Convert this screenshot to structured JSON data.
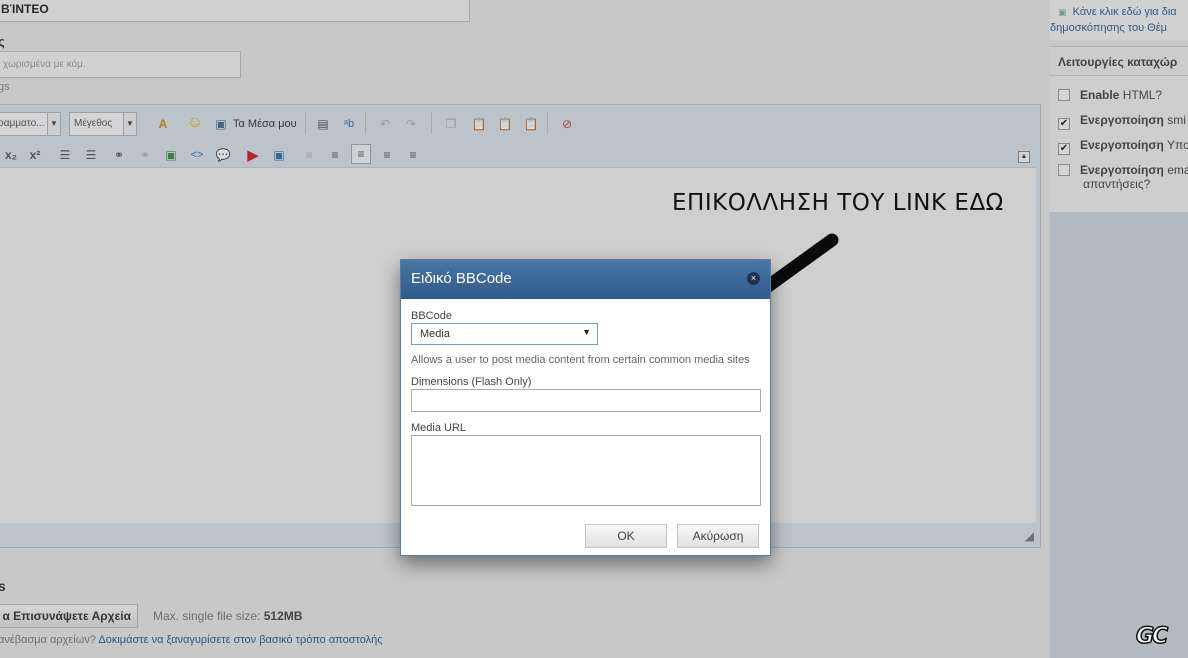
{
  "editor": {
    "title_value": "ΒΊΝΤΕΟ",
    "tags_label": "ς",
    "tags_placeholder": "χωρισμένα με κόμ.",
    "tags_hint": "gs",
    "toolbar": {
      "font_select": "ραμματο...",
      "size_select": "Μέγεθος",
      "my_media_label": "Τα Μέσα μου"
    }
  },
  "attachments": {
    "label": "s",
    "upload_button": "α Επισυνάψετε Αρχεία",
    "max_size_prefix": "Max. single file size:",
    "max_size_value": "512MB",
    "problem_text": "ανέβασμα αρχείων?",
    "problem_link": "Δοκιμάστε να ξαναγυρίσετε στον βασικό τρόπο αποστολής"
  },
  "sidebar": {
    "link_line1": "Κάνε κλικ εδώ για δια",
    "link_line2": "δημοσκόπησης του Θέμ",
    "section_title": "Λειτουργίες καταχώρ",
    "options": [
      {
        "bold": "Enable",
        "rest": "HTML?",
        "checked": false
      },
      {
        "bold": "Ενεργοποίηση",
        "rest": "smi",
        "checked": true
      },
      {
        "bold": "Ενεργοποίηση",
        "rest": "Υπο",
        "checked": true
      },
      {
        "bold": "Ενεργοποίηση",
        "rest": "ema",
        "rest2": "απαντήσεις?",
        "checked": false
      }
    ],
    "logo": "GC"
  },
  "annotation": "ΕΠΙΚΟΛΛΗΣΗ ΤΟΥ LINK ΕΔΩ",
  "dialog": {
    "title": "Ειδικό BBCode",
    "close_icon": "×",
    "bbcode_label": "BBCode",
    "bbcode_value": "Media",
    "description": "Allows a user to post media content from certain common media sites",
    "dimensions_label": "Dimensions (Flash Only)",
    "dimensions_value": "",
    "url_label": "Media URL",
    "url_value": "",
    "ok_label": "OK",
    "cancel_label": "Ακύρωση"
  },
  "colors": {
    "dialog_header": "#3b6797",
    "link": "#2b5b90",
    "editor_frame": "#d6dee6"
  }
}
